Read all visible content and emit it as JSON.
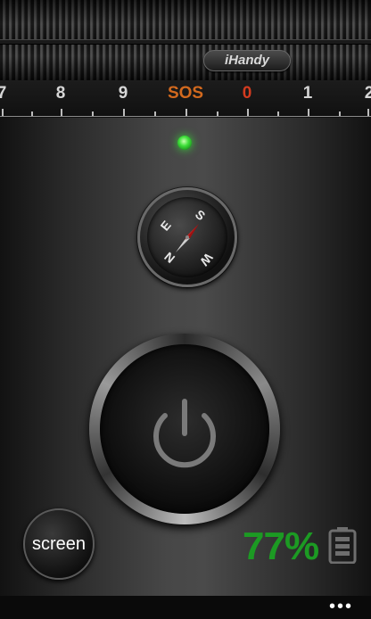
{
  "brand": {
    "label": "iHandy"
  },
  "scale": {
    "labels": [
      "7",
      "8",
      "9",
      "SOS",
      "0",
      "1",
      "2"
    ]
  },
  "compass": {
    "n": "N",
    "e": "E",
    "s": "S",
    "w": "W"
  },
  "controls": {
    "screen_label": "screen"
  },
  "battery": {
    "percent": "77%",
    "color": "#1c9a23"
  },
  "indicator": {
    "color": "#3fe03a"
  },
  "menu": {
    "more_label": "•••"
  }
}
